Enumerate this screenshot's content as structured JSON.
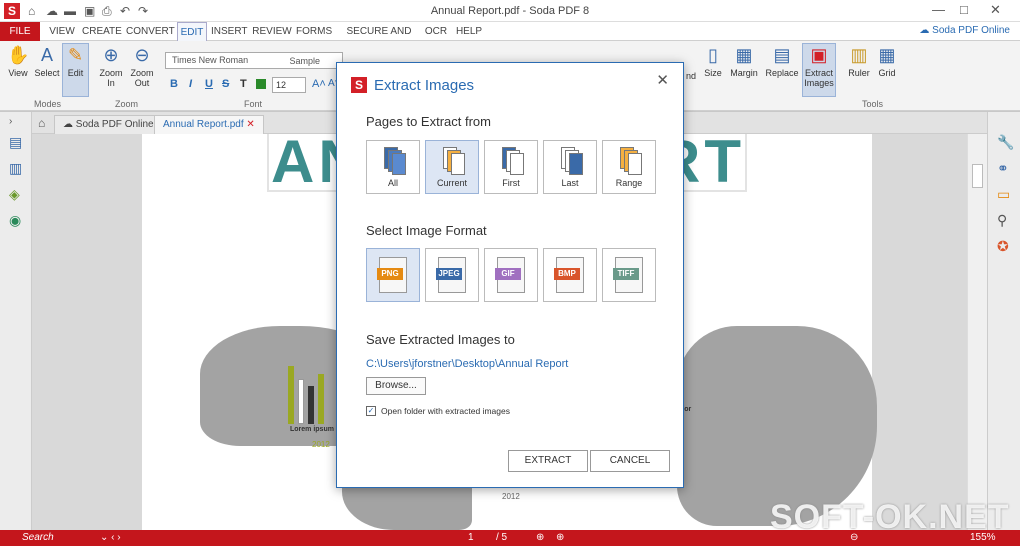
{
  "window": {
    "title": "Annual Report.pdf  -  Soda PDF 8",
    "online_link": "Soda PDF Online"
  },
  "menu": {
    "items": [
      "FILE",
      "VIEW",
      "CREATE",
      "CONVERT",
      "EDIT",
      "INSERT",
      "REVIEW",
      "FORMS",
      "SECURE AND SIGN",
      "OCR",
      "HELP"
    ]
  },
  "ribbon": {
    "view": "View",
    "select": "Select",
    "edit": "Edit",
    "zoom_in": "Zoom\nIn",
    "zoom_out": "Zoom\nOut",
    "font_name": "Times New Roman",
    "font_sample": "Sample",
    "font_size": "12",
    "bold": "B",
    "italic": "I",
    "underline": "U",
    "strike": "S",
    "text_t": "T",
    "nd": "nd",
    "size": "Size",
    "margin": "Margin",
    "replace": "Replace",
    "extract_images": "Extract\nImages",
    "ruler": "Ruler",
    "grid": "Grid",
    "group_modes": "Modes",
    "group_zoom": "Zoom",
    "group_font": "Font",
    "group_tools": "Tools"
  },
  "tabs": {
    "online": "Soda PDF Online",
    "doc": "Annual Report.pdf"
  },
  "document": {
    "title_left": "AN",
    "title_right": "RT",
    "label1": "Lorem ipsum d",
    "label2": "dor",
    "year": "2012",
    "year2": "2012"
  },
  "status": {
    "search_placeholder": "Search",
    "page_current": "1",
    "page_total": "/ 5",
    "zoom": "155%"
  },
  "watermark": "SOFT-OK.NET",
  "dialog": {
    "title": "Extract Images",
    "pages_heading": "Pages to Extract from",
    "page_options": [
      {
        "label": "All"
      },
      {
        "label": "Current"
      },
      {
        "label": "First"
      },
      {
        "label": "Last"
      },
      {
        "label": "Range"
      }
    ],
    "format_heading": "Select Image Format",
    "formats": [
      {
        "label": "PNG",
        "color": "#e58a12"
      },
      {
        "label": "JPEG",
        "color": "#3a6aa8"
      },
      {
        "label": "GIF",
        "color": "#a070c0"
      },
      {
        "label": "BMP",
        "color": "#d9552b"
      },
      {
        "label": "TIFF",
        "color": "#6a9a8a"
      }
    ],
    "save_heading": "Save Extracted Images to",
    "save_path": "C:\\Users\\jforstner\\Desktop\\Annual Report",
    "browse": "Browse...",
    "open_folder": "Open folder with extracted images",
    "extract": "EXTRACT",
    "cancel": "CANCEL"
  }
}
